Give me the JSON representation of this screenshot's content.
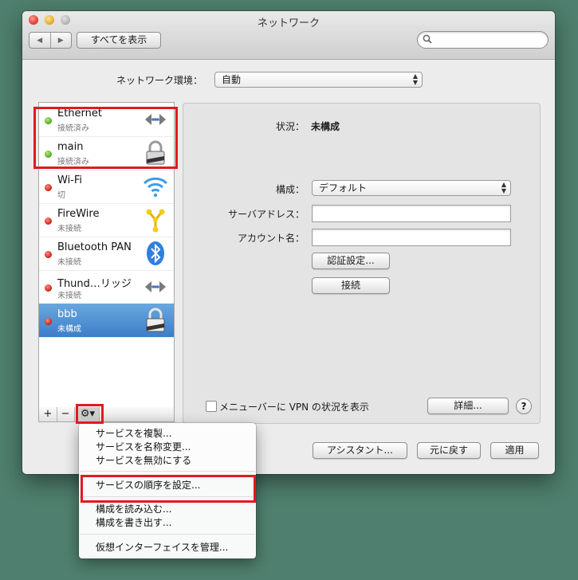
{
  "window": {
    "title": "ネットワーク"
  },
  "toolbar": {
    "back_glyph": "◀",
    "forward_glyph": "▶",
    "show_all_label": "すべてを表示",
    "search_placeholder": ""
  },
  "location": {
    "label": "ネットワーク環境：",
    "value": "自動"
  },
  "services": [
    {
      "name": "Ethernet",
      "status": "接続済み",
      "dot": "green",
      "icon": "ethernet-icon"
    },
    {
      "name": "main",
      "status": "接続済み",
      "dot": "green",
      "icon": "vpn-lock-icon"
    },
    {
      "name": "Wi-Fi",
      "status": "切",
      "dot": "red",
      "icon": "wifi-icon"
    },
    {
      "name": "FireWire",
      "status": "未接続",
      "dot": "red",
      "icon": "firewire-icon"
    },
    {
      "name": "Bluetooth PAN",
      "status": "未接続",
      "dot": "red",
      "icon": "bluetooth-icon"
    },
    {
      "name": "Thund…リッジ",
      "status": "未接続",
      "dot": "red",
      "icon": "thunderbolt-bridge-icon"
    },
    {
      "name": "bbb",
      "status": "未構成",
      "dot": "red",
      "icon": "vpn-lock-icon",
      "selected": true
    }
  ],
  "list_toolbar": {
    "add_label": "+",
    "remove_label": "−",
    "gear_label": "⚙▾"
  },
  "detail": {
    "status_label": "状況：",
    "status_value": "未構成",
    "config_label": "構成：",
    "config_value": "デフォルト",
    "server_label": "サーバアドレス：",
    "server_value": "",
    "account_label": "アカウント名：",
    "account_value": "",
    "auth_button": "認証設定...",
    "connect_button": "接続",
    "menubar_checkbox_label": "メニューバーに VPN の状況を表示",
    "advanced_button": "詳細...",
    "help_label": "?"
  },
  "footer": {
    "assistant_button": "アシスタント...",
    "revert_button": "元に戻す",
    "apply_button": "適用"
  },
  "gear_menu": {
    "group1": [
      "サービスを複製...",
      "サービスを名称変更...",
      "サービスを無効にする"
    ],
    "group2": [
      "サービスの順序を設定..."
    ],
    "group3": [
      "構成を読み込む...",
      "構成を書き出す..."
    ],
    "group4": [
      "仮想インターフェイスを管理..."
    ]
  },
  "colors": {
    "highlight_box": "#e01a22",
    "selection": "#3d7ec9",
    "desktop": "#4f7f6e"
  }
}
